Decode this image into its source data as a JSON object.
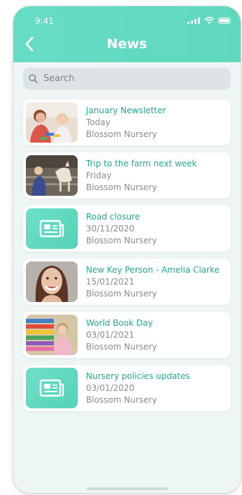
{
  "status_bar": {
    "time": "9:41"
  },
  "header": {
    "title": "News"
  },
  "search": {
    "placeholder": "Search"
  },
  "news": [
    {
      "title": "January Newsletter",
      "date": "Today",
      "source": "Blossom Nursery",
      "thumb": "photo-teacher-child"
    },
    {
      "title": "Trip to the farm next week",
      "date": "Friday",
      "source": "Blossom Nursery",
      "thumb": "photo-farm-goats"
    },
    {
      "title": "Road closure",
      "date": "30/11/2020",
      "source": "Blossom Nursery",
      "thumb": "newspaper-icon"
    },
    {
      "title": "New Key Person - Amelia Clarke",
      "date": "15/01/2021",
      "source": "Blossom Nursery",
      "thumb": "photo-portrait"
    },
    {
      "title": "World Book Day",
      "date": "03/01/2021",
      "source": "Blossom Nursery",
      "thumb": "photo-child-books"
    },
    {
      "title": "Nursery policies updates",
      "date": "03/01/2020",
      "source": "Blossom Nursery",
      "thumb": "newspaper-icon"
    }
  ],
  "colors": {
    "accent": "#5fd9bd",
    "title_text": "#25a98e",
    "meta_text": "#868d90"
  }
}
